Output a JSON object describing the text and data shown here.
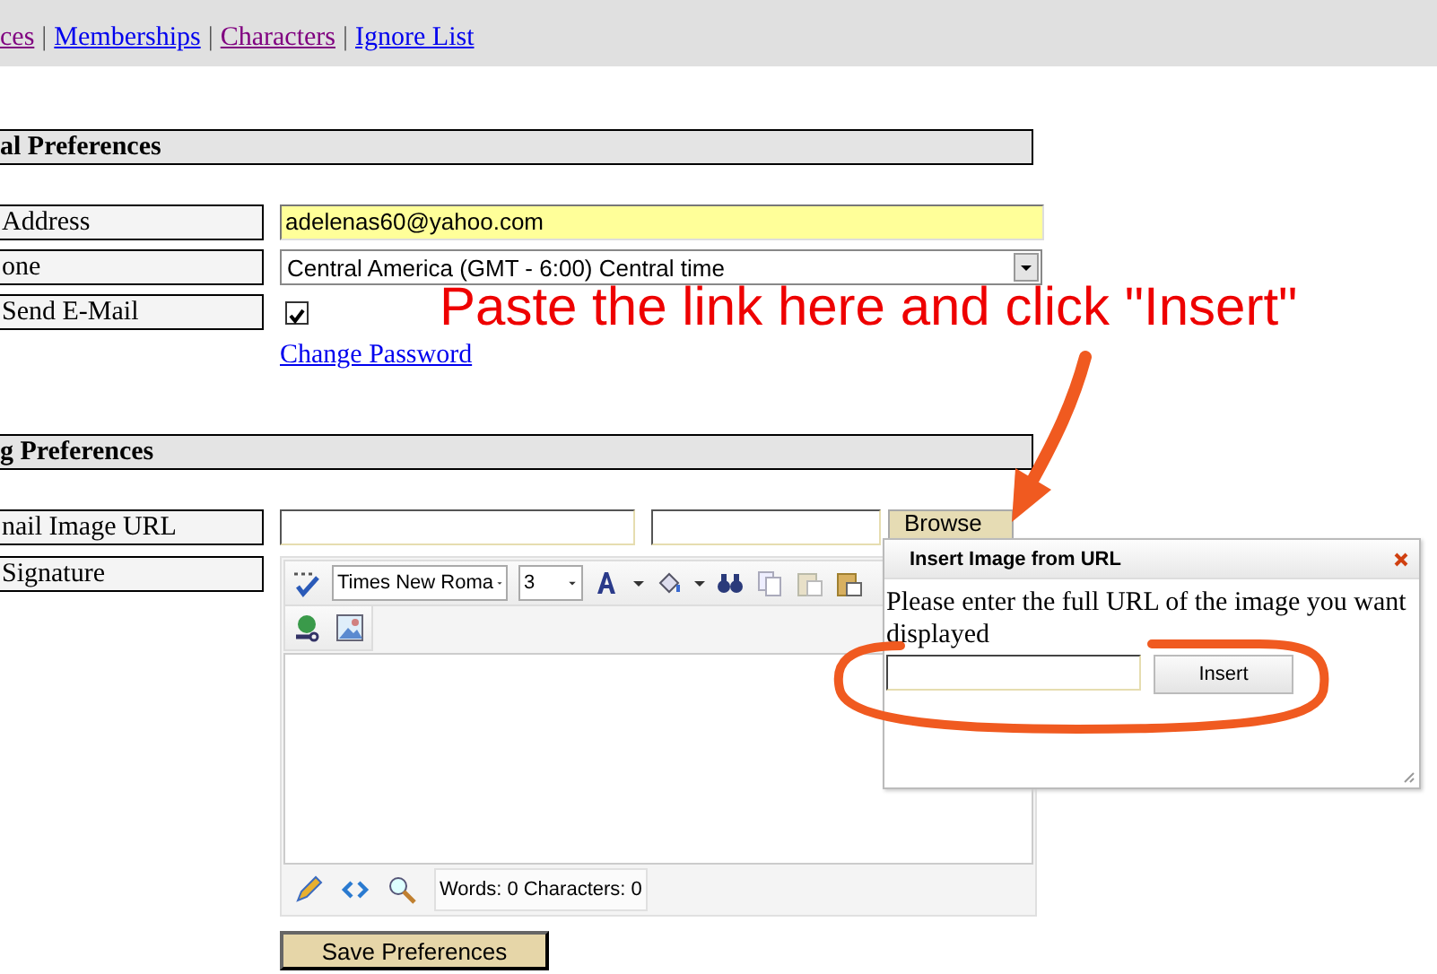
{
  "nav_links": [
    {
      "label": "ces",
      "visited": true
    },
    {
      "label": "Memberships",
      "visited": false
    },
    {
      "label": "Characters",
      "visited": true
    },
    {
      "label": "Ignore List",
      "visited": false
    }
  ],
  "separators": [
    "|",
    "|",
    "|"
  ],
  "sections": [
    {
      "title": "al Preferences",
      "rows": [
        {
          "kind": "text",
          "label": "Address",
          "value": "adelenas60@yahoo.com"
        },
        {
          "kind": "select",
          "label": "one",
          "value": "Central America (GMT - 6:00) Central time"
        },
        {
          "kind": "checkbox",
          "label": "Send E-Mail",
          "checked": true
        }
      ],
      "link": "Change Password"
    },
    {
      "title": "g Preferences",
      "rows": [
        {
          "kind": "upload",
          "label": "nail Image URL",
          "button": "Browse"
        },
        {
          "kind": "editor",
          "label": "Signature"
        }
      ]
    }
  ],
  "editor": {
    "font": "Times New Roma",
    "size": "3",
    "status": "Words: 0 Characters: 0"
  },
  "dialog": {
    "title": "Insert Image from URL",
    "message": "Please enter the full URL of the image you want displayed",
    "button": "Insert"
  },
  "annotation": {
    "text": "Paste the link here and click \"Insert\""
  },
  "save_button": "Save Preferences"
}
